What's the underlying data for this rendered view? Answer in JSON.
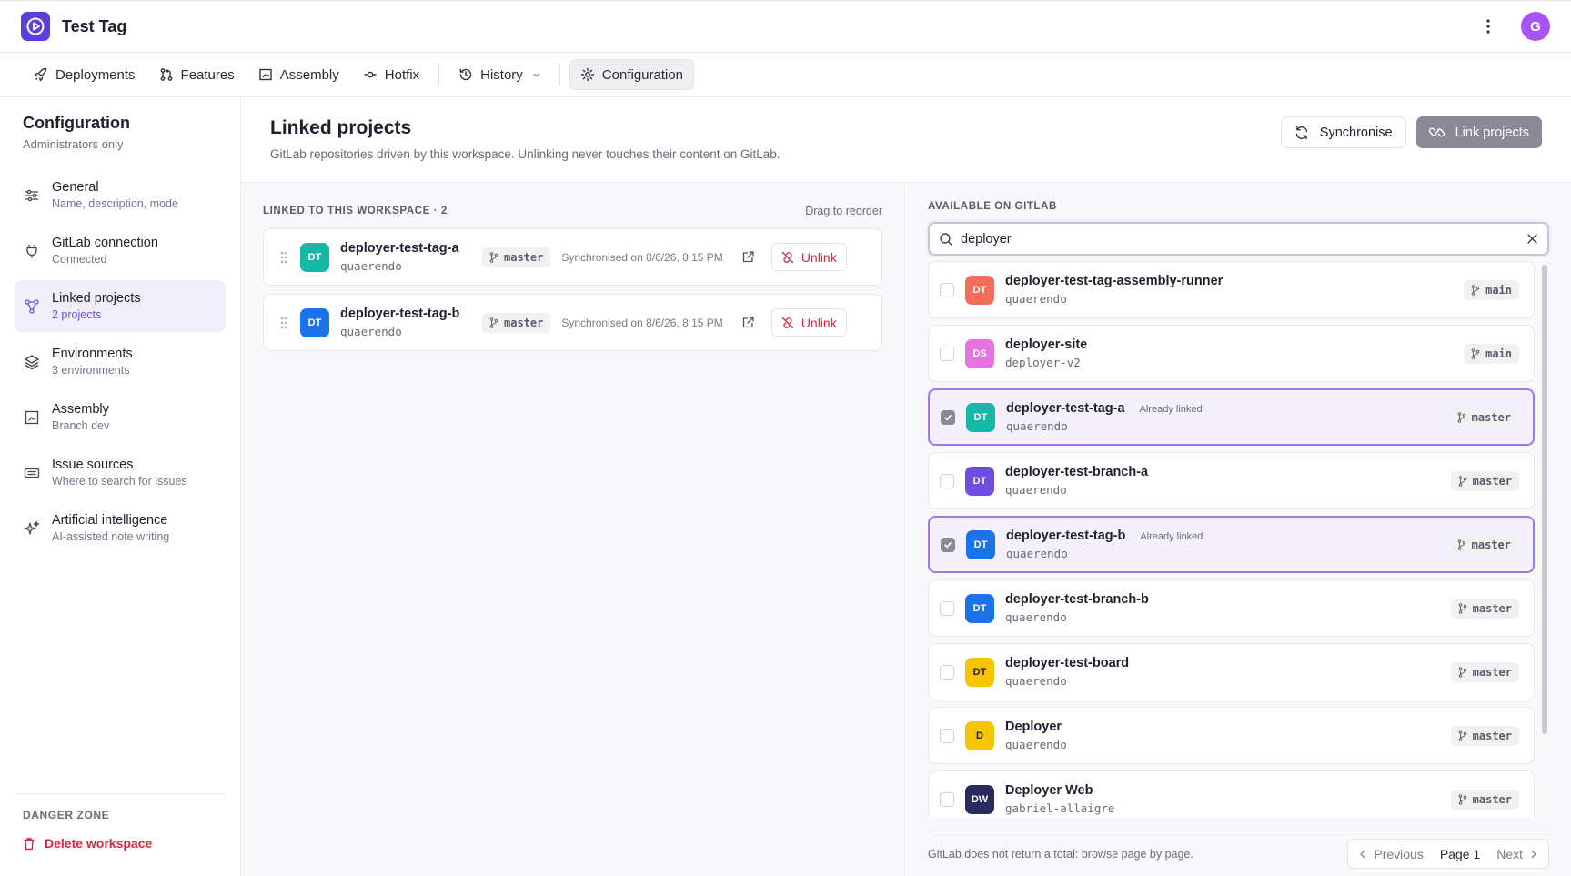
{
  "app": {
    "title": "Test Tag",
    "avatar_initial": "G"
  },
  "nav": {
    "tabs": [
      {
        "label": "Deployments",
        "icon": "rocket-icon"
      },
      {
        "label": "Features",
        "icon": "git-pull-request-icon"
      },
      {
        "label": "Assembly",
        "icon": "frame-icon"
      },
      {
        "label": "Hotfix",
        "icon": "git-commit-icon"
      },
      {
        "label": "History",
        "icon": "history-icon"
      },
      {
        "label": "Configuration",
        "icon": "gear-icon",
        "active": true
      }
    ]
  },
  "sidebar": {
    "title": "Configuration",
    "subtitle": "Administrators only",
    "items": [
      {
        "label": "General",
        "desc": "Name, description, mode",
        "icon": "sliders-icon"
      },
      {
        "label": "GitLab connection",
        "desc": "Connected",
        "icon": "plug-icon"
      },
      {
        "label": "Linked projects",
        "desc": "2 projects",
        "icon": "linked-nodes-icon",
        "active": true
      },
      {
        "label": "Environments",
        "desc": "3 environments",
        "icon": "layers-icon"
      },
      {
        "label": "Assembly",
        "desc": "Branch dev",
        "icon": "frame-icon"
      },
      {
        "label": "Issue sources",
        "desc": "Where to search for issues",
        "icon": "ticket-icon"
      },
      {
        "label": "Artificial intelligence",
        "desc": "AI-assisted note writing",
        "icon": "sparkles-icon"
      }
    ],
    "danger_title": "DANGER ZONE",
    "delete_label": "Delete workspace"
  },
  "page": {
    "title": "Linked projects",
    "description": "GitLab repositories driven by this workspace. Unlinking never touches their content on GitLab.",
    "sync_label": "Synchronise",
    "link_label": "Link projects"
  },
  "linked": {
    "label": "LINKED TO THIS WORKSPACE · 2",
    "hint": "Drag to reorder",
    "unlink_label": "Unlink",
    "projects": [
      {
        "initials": "DT",
        "color": "#14b8a6",
        "name": "deployer-test-tag-a",
        "owner": "quaerendo",
        "branch": "master",
        "synced": "Synchronised on 8/6/26, 8:15 PM"
      },
      {
        "initials": "DT",
        "color": "#1a73e8",
        "name": "deployer-test-tag-b",
        "owner": "quaerendo",
        "branch": "master",
        "synced": "Synchronised on 8/6/26, 8:15 PM"
      }
    ]
  },
  "available": {
    "label": "AVAILABLE ON GITLAB",
    "search_value": "deployer",
    "already_label": "Already linked",
    "results": [
      {
        "initials": "DT",
        "color": "#f26d5b",
        "name": "deployer-test-tag-assembly-runner",
        "owner": "quaerendo",
        "branch": "main",
        "linked": false
      },
      {
        "initials": "DS",
        "color": "#e573e0",
        "name": "deployer-site",
        "owner": "deployer-v2",
        "branch": "main",
        "linked": false
      },
      {
        "initials": "DT",
        "color": "#14b8a6",
        "name": "deployer-test-tag-a",
        "owner": "quaerendo",
        "branch": "master",
        "linked": true
      },
      {
        "initials": "DT",
        "color": "#6d4ee0",
        "name": "deployer-test-branch-a",
        "owner": "quaerendo",
        "branch": "master",
        "linked": false
      },
      {
        "initials": "DT",
        "color": "#1a73e8",
        "name": "deployer-test-tag-b",
        "owner": "quaerendo",
        "branch": "master",
        "linked": true
      },
      {
        "initials": "DT",
        "color": "#1a73e8",
        "name": "deployer-test-branch-b",
        "owner": "quaerendo",
        "branch": "master",
        "linked": false
      },
      {
        "initials": "DT",
        "color": "#f7c400",
        "name": "deployer-test-board",
        "owner": "quaerendo",
        "branch": "master",
        "linked": false,
        "dark_text": true
      },
      {
        "initials": "D",
        "color": "#f7c400",
        "name": "Deployer",
        "owner": "quaerendo",
        "branch": "master",
        "linked": false,
        "dark_text": true
      },
      {
        "initials": "DW",
        "color": "#2b2a5e",
        "name": "Deployer Web",
        "owner": "gabriel-allaigre",
        "branch": "master",
        "linked": false
      }
    ],
    "pager_note": "GitLab does not return a total: browse page by page.",
    "previous_label": "Previous",
    "page_label": "Page 1",
    "next_label": "Next"
  }
}
